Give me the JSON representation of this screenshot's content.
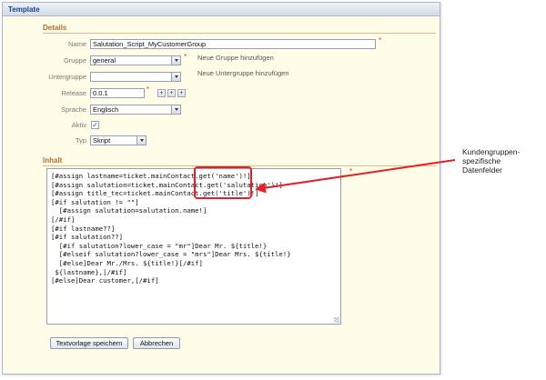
{
  "window": {
    "title": "Template"
  },
  "details": {
    "header": "Details",
    "name": {
      "label": "Name",
      "value": "Salutation_Script_MyCustomerGroup"
    },
    "group": {
      "label": "Gruppe",
      "value": "general",
      "hint": "Neue Gruppe hinzufügen"
    },
    "subgroup": {
      "label": "Untergruppe",
      "value": "",
      "hint": "Neue Untergruppe hinzufügen"
    },
    "release": {
      "label": "Release",
      "value": "0.0.1",
      "buttons": [
        "+",
        "+",
        "+"
      ]
    },
    "language": {
      "label": "Sprache",
      "value": "Englisch"
    },
    "active": {
      "label": "Aktiv",
      "checked": "✓"
    },
    "type": {
      "label": "Typ",
      "value": "Skript"
    }
  },
  "content": {
    "header": "Inhalt",
    "lines": [
      "[#assign lastname=ticket.mainContact.get('name')!]",
      "[#assign salutation=ticket.mainContact.get('salutation')!]",
      "[#assign title_tec=ticket.mainContact.get('title')!]",
      "[#if salutation != \"\"]",
      "  [#assign salutation=salutation.name!]",
      "[/#if]",
      "",
      "[#if lastname??]",
      "[#if salutation??]",
      "  [#if salutation?lower_case = \"mr\"]Dear Mr. ${title!}",
      "  [#elseif salutation?lower_case = \"mrs\"]Dear Mrs. ${title!}",
      "  [#else]Dear Mr./Mrs. ${title!}[/#if]",
      " ${lastname},[/#if]",
      "[#else]Dear customer,[/#if]"
    ]
  },
  "buttons": {
    "save": "Textvorlage speichern",
    "cancel": "Abbrechen"
  },
  "required_marker": "*",
  "annotation": {
    "line1": "Kundengruppen-",
    "line2": "spezifische",
    "line3": "Datenfelder"
  },
  "colors": {
    "accent": "#b86a2a",
    "required": "#e23b2e",
    "callout": "#e41f26"
  }
}
